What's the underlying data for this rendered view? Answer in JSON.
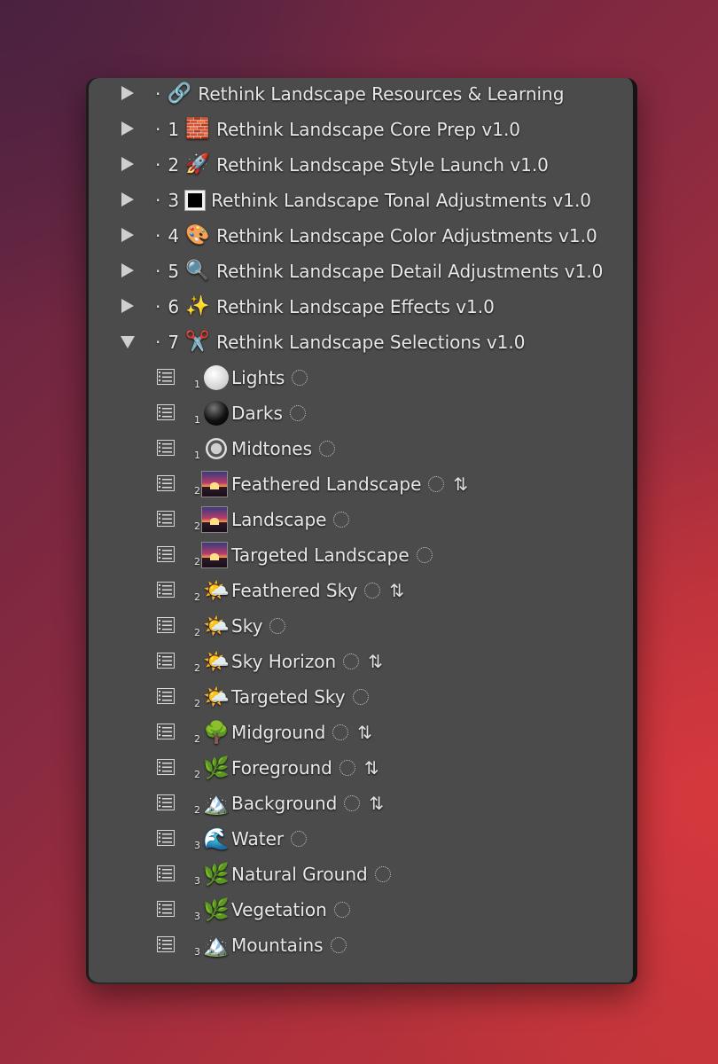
{
  "folders": [
    {
      "dot": "·",
      "num": "",
      "icon": "🔗",
      "label": "Rethink Landscape Resources & Learning"
    },
    {
      "dot": "·",
      "num": "1",
      "icon": "🧱",
      "label": "Rethink Landscape Core Prep v1.0"
    },
    {
      "dot": "·",
      "num": "2",
      "icon": "🚀",
      "label": "Rethink Landscape Style Launch v1.0"
    },
    {
      "dot": "·",
      "num": "3",
      "icon": "square",
      "label": "Rethink Landscape Tonal Adjustments v1.0"
    },
    {
      "dot": "·",
      "num": "4",
      "icon": "🎨",
      "label": "Rethink Landscape Color Adjustments v1.0"
    },
    {
      "dot": "·",
      "num": "5",
      "icon": "🔍",
      "label": "Rethink Landscape Detail Adjustments v1.0"
    },
    {
      "dot": "·",
      "num": "6",
      "icon": "✨",
      "label": "Rethink Landscape Effects v1.0"
    },
    {
      "dot": "·",
      "num": "7",
      "icon": "✂️",
      "label": "Rethink Landscape Selections v1.0"
    }
  ],
  "presets": [
    {
      "sub": "1",
      "icon": "ball-light",
      "label": "Lights",
      "swap": false
    },
    {
      "sub": "1",
      "icon": "ball-dark",
      "label": "Darks",
      "swap": false
    },
    {
      "sub": "1",
      "icon": "ball-mid",
      "label": "Midtones",
      "swap": false
    },
    {
      "sub": "2",
      "icon": "sunset-thumb",
      "label": "Feathered Landscape",
      "swap": true
    },
    {
      "sub": "2",
      "icon": "sunset-thumb",
      "label": "Landscape",
      "swap": false
    },
    {
      "sub": "2",
      "icon": "sunset-thumb",
      "label": "Targeted Landscape",
      "swap": false
    },
    {
      "sub": "2",
      "icon": "🌤️",
      "label": "Feathered Sky",
      "swap": true
    },
    {
      "sub": "2",
      "icon": "🌤️",
      "label": "Sky",
      "swap": false
    },
    {
      "sub": "2",
      "icon": "🌤️",
      "label": "Sky Horizon",
      "swap": true
    },
    {
      "sub": "2",
      "icon": "🌤️",
      "label": "Targeted Sky",
      "swap": false
    },
    {
      "sub": "2",
      "icon": "🌳",
      "label": "Midground",
      "swap": true
    },
    {
      "sub": "2",
      "icon": "🌿",
      "label": "Foreground",
      "swap": true
    },
    {
      "sub": "2",
      "icon": "🏔️",
      "label": "Background",
      "swap": true
    },
    {
      "sub": "3",
      "icon": "🌊",
      "label": "Water",
      "swap": false
    },
    {
      "sub": "3",
      "icon": "🌿",
      "label": "Natural Ground",
      "swap": false
    },
    {
      "sub": "3",
      "icon": "🌿",
      "label": "Vegetation",
      "swap": false
    },
    {
      "sub": "3",
      "icon": "🏔️",
      "label": "Mountains",
      "swap": false
    }
  ],
  "swap_glyph": "⇅"
}
